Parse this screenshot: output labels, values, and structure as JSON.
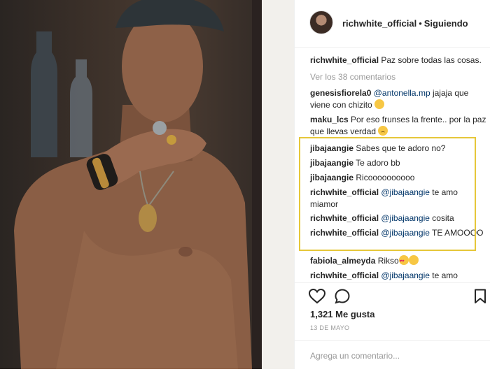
{
  "header": {
    "username": "richwhite_official",
    "separator": "•",
    "follow_status": "Siguiendo"
  },
  "caption": {
    "username": "richwhite_official",
    "text": "Paz sobre todas las cosas."
  },
  "view_all_comments": "Ver los 38 comentarios",
  "comments": [
    {
      "username": "genesisfiorela0",
      "mention": "@antonella.mp",
      "text": " jajaja que viene con chizito ",
      "emoji": "laughing-crying"
    },
    {
      "username": "maku_lcs",
      "mention": "",
      "text": "Por eso frunses la frente.. por la paz que llevas verdad ",
      "emoji": "sad-face"
    },
    {
      "username": "jibajaangie",
      "mention": "",
      "text": "Sabes que te adoro no?"
    },
    {
      "username": "jibajaangie",
      "mention": "",
      "text": "Te adoro bb"
    },
    {
      "username": "jibajaangie",
      "mention": "",
      "text": "Ricoooooooooo"
    },
    {
      "username": "richwhite_official",
      "mention": "@jibajaangie",
      "text": " te amo miamor"
    },
    {
      "username": "richwhite_official",
      "mention": "@jibajaangie",
      "text": " cosita"
    },
    {
      "username": "richwhite_official",
      "mention": "@jibajaangie",
      "text": " TE AMOOOO"
    },
    {
      "username": "fabiola_almeyda",
      "mention": "",
      "text": "Rikso",
      "emoji": "heart-eyes"
    },
    {
      "username": "richwhite_official",
      "mention": "@jibajaangie",
      "text": " te amo"
    }
  ],
  "likes": "1,321 Me gusta",
  "date": "13 DE MAYO",
  "add_comment_placeholder": "Agrega un comentario...",
  "colors": {
    "highlight_border": "#e6c73a",
    "mention": "#003569",
    "muted": "#999999"
  }
}
